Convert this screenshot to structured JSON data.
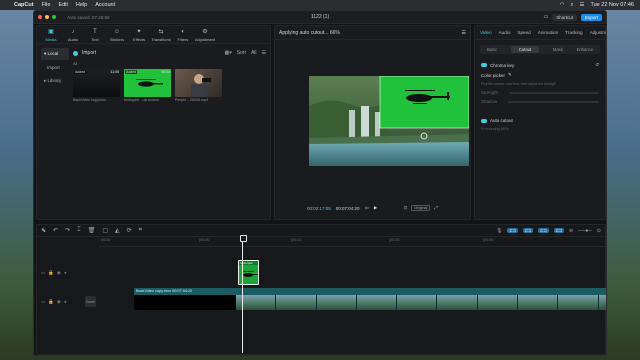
{
  "menubar": {
    "apple": "",
    "app_name": "CapCut",
    "items": [
      "File",
      "Edit",
      "Help",
      "Account"
    ],
    "datetime": "Tue 22 Nov  07:46"
  },
  "window": {
    "autosave": "Auto saved: 07:45:58",
    "title": "1122 (1)",
    "shortcut_label": "Shortcut",
    "export_label": "Export"
  },
  "media": {
    "tools": [
      {
        "label": "Media",
        "icon": "▣",
        "active": true
      },
      {
        "label": "Audio",
        "icon": "♪",
        "active": false
      },
      {
        "label": "Text",
        "icon": "T",
        "active": false
      },
      {
        "label": "Stickers",
        "icon": "☺",
        "active": false
      },
      {
        "label": "Effects",
        "icon": "✦",
        "active": false
      },
      {
        "label": "Transitions",
        "icon": "⇆",
        "active": false
      },
      {
        "label": "Filters",
        "icon": "◐",
        "active": false
      },
      {
        "label": "Adjustment",
        "icon": "⚙",
        "active": false
      }
    ],
    "side": [
      {
        "label": "▾ Local",
        "selected": true,
        "sub": false
      },
      {
        "label": "Import",
        "selected": false,
        "sub": true
      },
      {
        "label": "▸ Library",
        "selected": false,
        "sub": false
      }
    ],
    "import_label": "Import",
    "sort_label": "Sort",
    "all_filter": "All",
    "all_label": "All",
    "thumbs": [
      {
        "badge": "Added",
        "duration": "11:05",
        "caption": "BackVideo copy.mov",
        "kind": "dark"
      },
      {
        "badge": "Added",
        "duration": "00:24",
        "caption": "helicopter ...ck screen",
        "kind": "green"
      },
      {
        "badge": "",
        "duration": "",
        "caption": "People ...28005.mp4",
        "kind": "person"
      }
    ]
  },
  "player": {
    "status": "Applying auto cutout... 66%",
    "progress_percent": 66,
    "timecode_current": "00:02:17:05",
    "timecode_total": "00:07:04:20",
    "original_label": "Original"
  },
  "props": {
    "tabs": [
      "Video",
      "Audio",
      "Speed",
      "Animation",
      "Tracking",
      "Adjustment"
    ],
    "active_tab": "Video",
    "subtabs": [
      "Basic",
      "Cutout",
      "Mask",
      "Enhance"
    ],
    "active_subtab": "Cutout",
    "chroma_key": "Chroma key",
    "color_picker": "Color picker",
    "picker_hint": "Pick the screen color first, then adjust the strength",
    "strength": "Strength",
    "shadow": "Shadow",
    "auto_cutout": "Auto cutout",
    "auto_cutout_status": "Processing 66%"
  },
  "timeline": {
    "ruler": [
      "00:00",
      "|00:00",
      "|00:10",
      "|00:20",
      "|00:30"
    ],
    "green_clip_label": "helicopter",
    "main_clip_label": "BackVideo copy.mov   00:07:04:20",
    "cover_label": "Cover",
    "frame_count": 10
  },
  "colors": {
    "accent": "#3fd0e0",
    "export_blue": "#1f8ee8",
    "green_screen": "#1fc23a"
  }
}
